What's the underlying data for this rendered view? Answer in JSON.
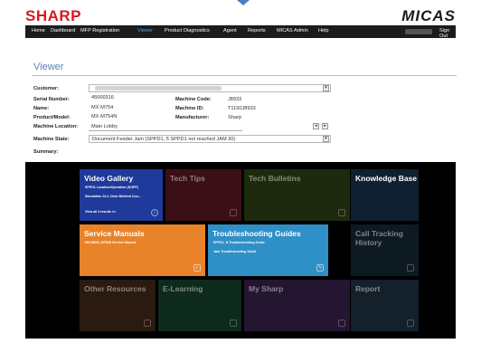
{
  "header": {
    "brand_left": "SHARP",
    "brand_right": "MICAS"
  },
  "nav": {
    "items": [
      "Home",
      "Dashboard",
      "MFP Registration",
      "Viewer",
      "Product Diagnostics",
      "Agent",
      "Reports",
      "MICAS Admin",
      "Help"
    ],
    "active": "Viewer",
    "sign_out": "Sign Out"
  },
  "page": {
    "title": "Viewer"
  },
  "info": {
    "customer_label": "Customer:",
    "serial_label": "Serial Number:",
    "serial_value": "45000316",
    "name_label": "Name:",
    "name_value": "MX-M754",
    "product_label": "Product/Model:",
    "product_value": "MX-M754N",
    "location_label": "Machine Location:",
    "location_value": "Main Lobby",
    "code_label": "Machine Code:",
    "code_value": "J8933",
    "id_label": "Machine ID:",
    "id_value": "T1150J8933",
    "manufacturer_label": "Manufacturer:",
    "manufacturer_value": "Sharp",
    "state_label": "Machine State:",
    "state_value": "Document Feeder Jam (SPPD1, 5 SPPD1 not reached JAM 30)",
    "summary_label": "Summary:"
  },
  "tiles": {
    "video_gallery": {
      "title": "Video Gallery",
      "line1": "SPPD1 Location/Operation (SOPF)",
      "line2": "Simulation 24-1 Clear Misfeed Cou...",
      "more": "View all 3 results >>"
    },
    "tech_tips": {
      "title": "Tech Tips"
    },
    "tech_bulletins": {
      "title": "Tech Bulletins"
    },
    "knowledge_base": {
      "title": "Knowledge Base"
    },
    "service_manuals": {
      "title": "Service Manuals",
      "line1": "MX-M654, M754N Service Manual"
    },
    "troubleshooting": {
      "title": "Troubleshooting Guides",
      "line1": "SPPD1_N Troubleshooting Guide",
      "line2": "Jam Troubleshooting Guide"
    },
    "call_tracking": {
      "title": "Call Tracking History"
    },
    "other_resources": {
      "title": "Other Resources"
    },
    "e_learning": {
      "title": "E-Learning"
    },
    "my_sharp": {
      "title": "My Sharp"
    },
    "report": {
      "title": "Report"
    }
  },
  "colors": {
    "brand_red": "#d71920",
    "nav_bg": "#1c1c1c",
    "active_nav": "#5aa3e0",
    "video_tile": "#1f3a9a",
    "service_tile": "#e8832a",
    "trouble_tile": "#2f8fc7"
  }
}
